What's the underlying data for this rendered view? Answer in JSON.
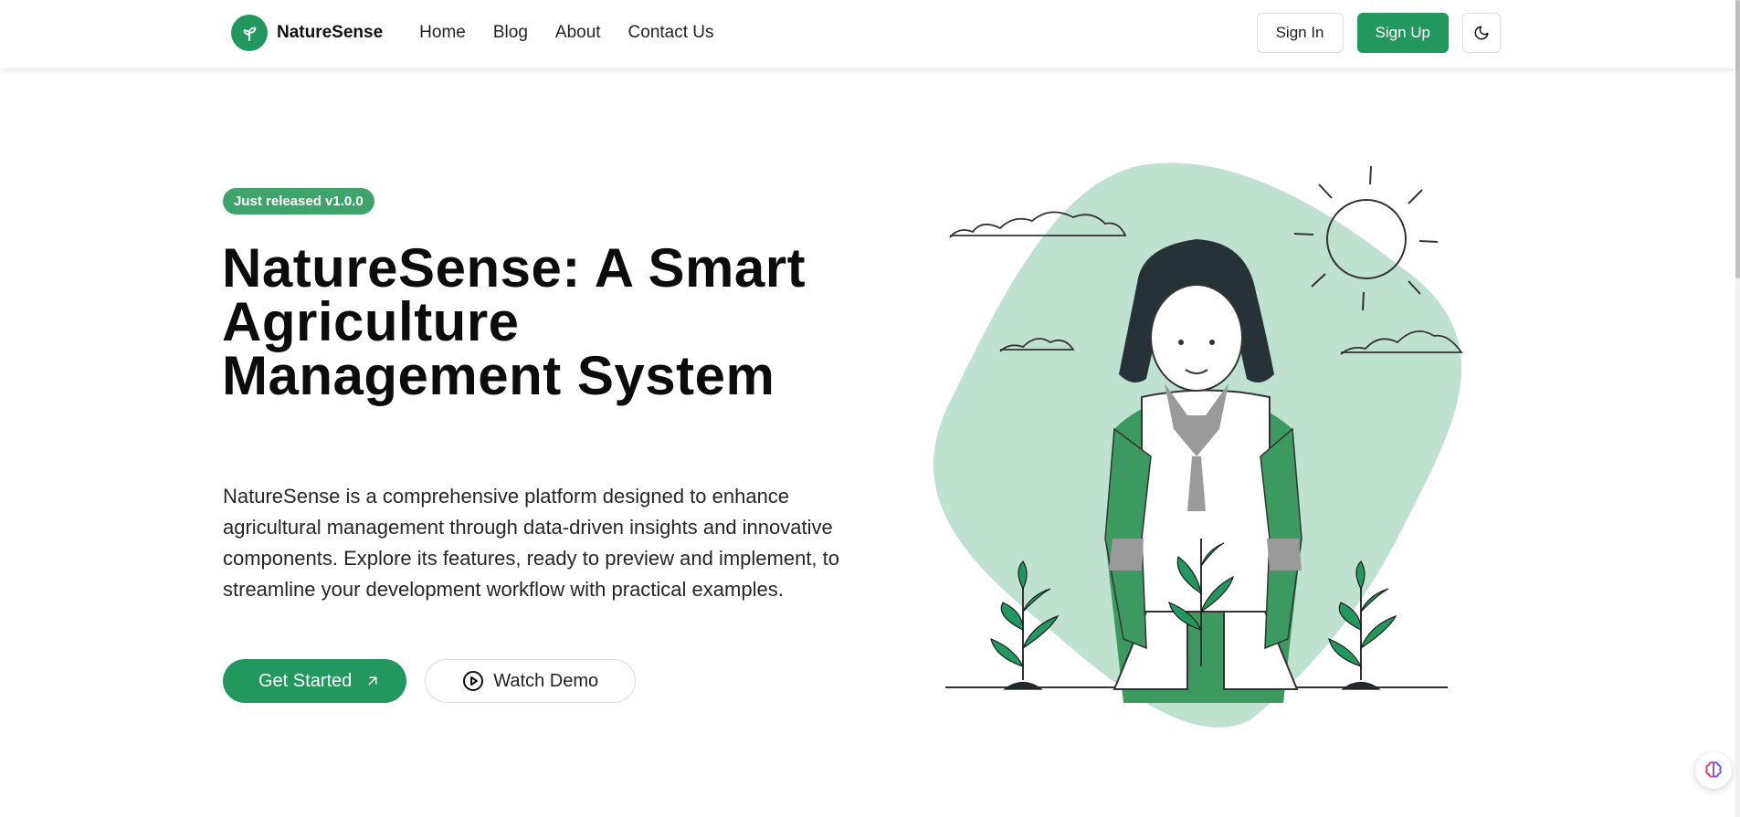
{
  "header": {
    "brand": "NatureSense",
    "nav": [
      "Home",
      "Blog",
      "About",
      "Contact Us"
    ],
    "sign_in": "Sign In",
    "sign_up": "Sign Up"
  },
  "hero": {
    "badge": "Just released v1.0.0",
    "title": "NatureSense: A Smart Agriculture Management System",
    "description": "NatureSense is a comprehensive platform designed to enhance agricultural management through data-driven insights and innovative components. Explore its features, ready to preview and implement, to streamline your development workflow with practical examples.",
    "cta_primary": "Get Started",
    "cta_secondary": "Watch Demo"
  },
  "icons": {
    "logo": "sprout-icon",
    "theme": "moon-icon",
    "primary_cta": "arrow-up-right-icon",
    "secondary_cta": "play-circle-icon",
    "assistant": "brain-icon"
  },
  "colors": {
    "accent": "#22985e",
    "badge": "#3ea46b",
    "blob": "#bfe1cf"
  }
}
